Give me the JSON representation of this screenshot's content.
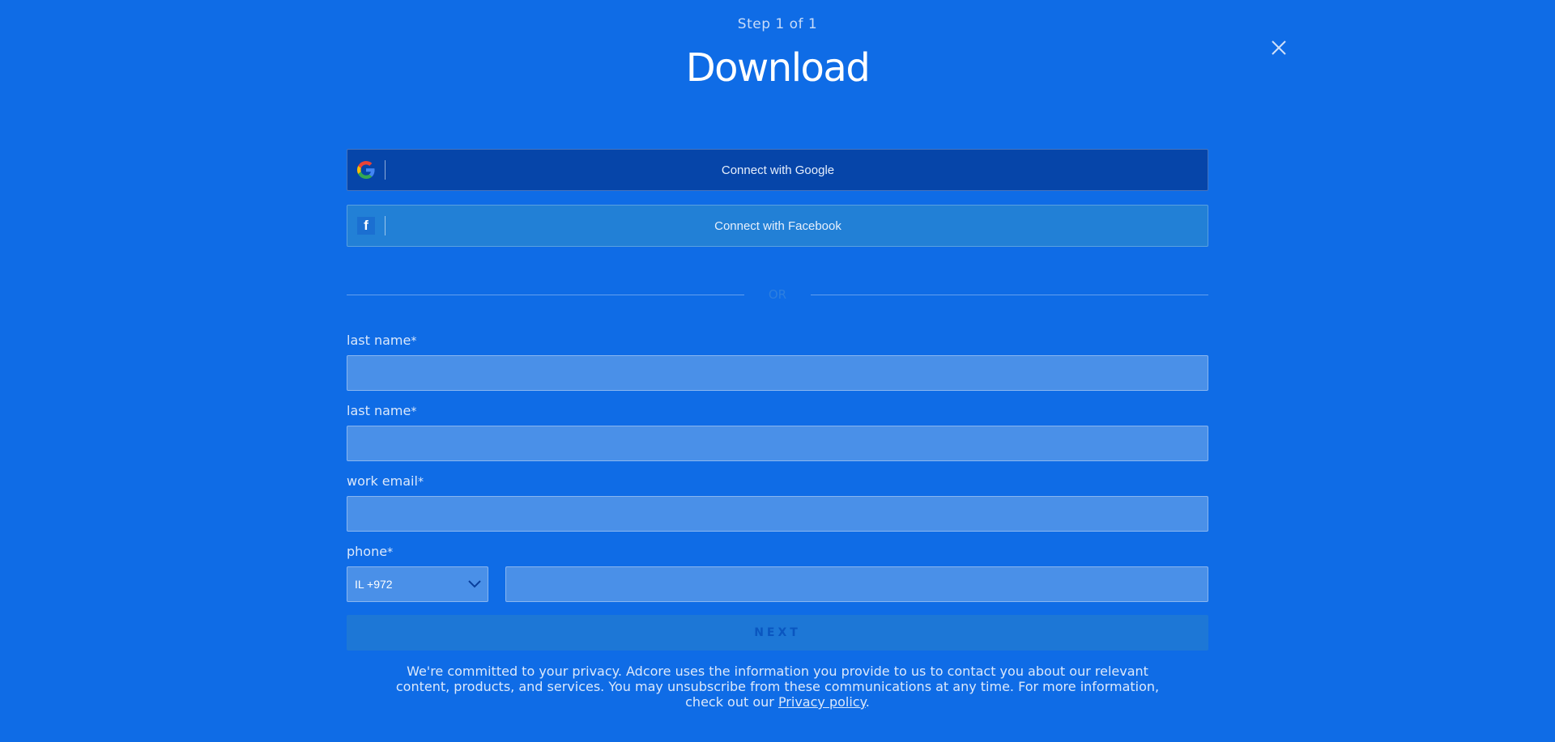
{
  "header": {
    "step": "Step 1 of 1",
    "title": "Download",
    "close_icon": "close-icon"
  },
  "social": {
    "google_label": "Connect with Google",
    "google_icon": "google-icon",
    "facebook_label": "Connect with Facebook",
    "facebook_icon": "facebook-icon",
    "facebook_glyph": "f"
  },
  "divider": {
    "text": "OR"
  },
  "form": {
    "field1_label": "last name",
    "field2_label": "last name",
    "email_label": "work email",
    "phone_label": "phone",
    "required_mark": "*",
    "field1_value": "",
    "field2_value": "",
    "email_value": "",
    "phone_value": "",
    "country_code": "IL +972",
    "next_label": "NEXT"
  },
  "privacy": {
    "text": "We're committed to your privacy. Adcore uses the information you provide to us to contact you about our relevant content, products, and services. You may unsubscribe from these communications at any time. For more information, check out our ",
    "link_text": "Privacy policy",
    "end": "."
  },
  "colors": {
    "background": "#0f6ce6",
    "google_button": "#0645a9",
    "facebook_button": "#2280d6",
    "input_bg": "#4a90e8",
    "next_button": "#1d77d6"
  }
}
